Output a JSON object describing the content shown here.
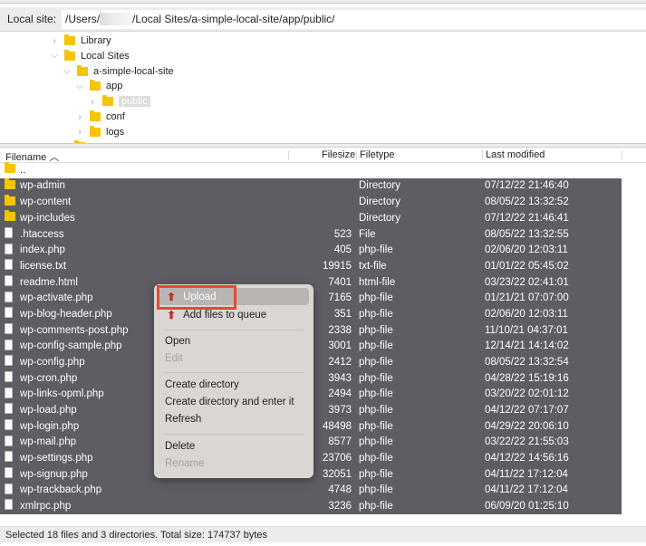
{
  "local_site": {
    "label": "Local site:",
    "path_prefix": "/Users/",
    "path_suffix": "/Local Sites/a-simple-local-site/app/public/"
  },
  "tree": [
    {
      "label": "Library",
      "level": 0,
      "expanded": false
    },
    {
      "label": "Local Sites",
      "level": 0,
      "expanded": true
    },
    {
      "label": "a-simple-local-site",
      "level": 1,
      "expanded": true
    },
    {
      "label": "app",
      "level": 2,
      "expanded": true
    },
    {
      "label": "public",
      "level": 3,
      "expanded": false,
      "selected": true
    },
    {
      "label": "conf",
      "level": 2,
      "expanded": false
    },
    {
      "label": "logs",
      "level": 2,
      "expanded": false
    }
  ],
  "columns": {
    "filename": "Filename",
    "filesize": "Filesize",
    "filetype": "Filetype",
    "modified": "Last modified"
  },
  "files": [
    {
      "name": "..",
      "size": "",
      "type": "",
      "modified": "",
      "kind": "dir",
      "selected": false
    },
    {
      "name": "wp-admin",
      "size": "",
      "type": "Directory",
      "modified": "07/12/22 21:46:40",
      "kind": "dir",
      "selected": true
    },
    {
      "name": "wp-content",
      "size": "",
      "type": "Directory",
      "modified": "08/05/22 13:32:52",
      "kind": "dir",
      "selected": true
    },
    {
      "name": "wp-includes",
      "size": "",
      "type": "Directory",
      "modified": "07/12/22 21:46:41",
      "kind": "dir",
      "selected": true
    },
    {
      "name": ".htaccess",
      "size": "523",
      "type": "File",
      "modified": "08/05/22 13:32:55",
      "kind": "file",
      "selected": true
    },
    {
      "name": "index.php",
      "size": "405",
      "type": "php-file",
      "modified": "02/06/20 12:03:11",
      "kind": "file",
      "selected": true
    },
    {
      "name": "license.txt",
      "size": "19915",
      "type": "txt-file",
      "modified": "01/01/22 05:45:02",
      "kind": "file",
      "selected": true
    },
    {
      "name": "readme.html",
      "size": "7401",
      "type": "html-file",
      "modified": "03/23/22 02:41:01",
      "kind": "file",
      "selected": true
    },
    {
      "name": "wp-activate.php",
      "size": "7165",
      "type": "php-file",
      "modified": "01/21/21 07:07:00",
      "kind": "file",
      "selected": true
    },
    {
      "name": "wp-blog-header.php",
      "size": "351",
      "type": "php-file",
      "modified": "02/06/20 12:03:11",
      "kind": "file",
      "selected": true
    },
    {
      "name": "wp-comments-post.php",
      "size": "2338",
      "type": "php-file",
      "modified": "11/10/21 04:37:01",
      "kind": "file",
      "selected": true
    },
    {
      "name": "wp-config-sample.php",
      "size": "3001",
      "type": "php-file",
      "modified": "12/14/21 14:14:02",
      "kind": "file",
      "selected": true
    },
    {
      "name": "wp-config.php",
      "size": "2412",
      "type": "php-file",
      "modified": "08/05/22 13:32:54",
      "kind": "file",
      "selected": true
    },
    {
      "name": "wp-cron.php",
      "size": "3943",
      "type": "php-file",
      "modified": "04/28/22 15:19:16",
      "kind": "file",
      "selected": true
    },
    {
      "name": "wp-links-opml.php",
      "size": "2494",
      "type": "php-file",
      "modified": "03/20/22 02:01:12",
      "kind": "file",
      "selected": true
    },
    {
      "name": "wp-load.php",
      "size": "3973",
      "type": "php-file",
      "modified": "04/12/22 07:17:07",
      "kind": "file",
      "selected": true
    },
    {
      "name": "wp-login.php",
      "size": "48498",
      "type": "php-file",
      "modified": "04/29/22 20:06:10",
      "kind": "file",
      "selected": true
    },
    {
      "name": "wp-mail.php",
      "size": "8577",
      "type": "php-file",
      "modified": "03/22/22 21:55:03",
      "kind": "file",
      "selected": true
    },
    {
      "name": "wp-settings.php",
      "size": "23706",
      "type": "php-file",
      "modified": "04/12/22 14:56:16",
      "kind": "file",
      "selected": true
    },
    {
      "name": "wp-signup.php",
      "size": "32051",
      "type": "php-file",
      "modified": "04/11/22 17:12:04",
      "kind": "file",
      "selected": true
    },
    {
      "name": "wp-trackback.php",
      "size": "4748",
      "type": "php-file",
      "modified": "04/11/22 17:12:04",
      "kind": "file",
      "selected": true
    },
    {
      "name": "xmlrpc.php",
      "size": "3236",
      "type": "php-file",
      "modified": "06/09/20 01:25:10",
      "kind": "file",
      "selected": true
    }
  ],
  "context_menu": {
    "upload": "Upload",
    "add_to_queue": "Add files to queue",
    "open": "Open",
    "edit": "Edit",
    "create_dir": "Create directory",
    "create_dir_enter": "Create directory and enter it",
    "refresh": "Refresh",
    "delete": "Delete",
    "rename": "Rename"
  },
  "status": "Selected 18 files and 3 directories. Total size: 174737 bytes",
  "colors": {
    "selection": "#5e5d63",
    "highlight_box": "#e8492e",
    "folder": "#f7c400"
  }
}
